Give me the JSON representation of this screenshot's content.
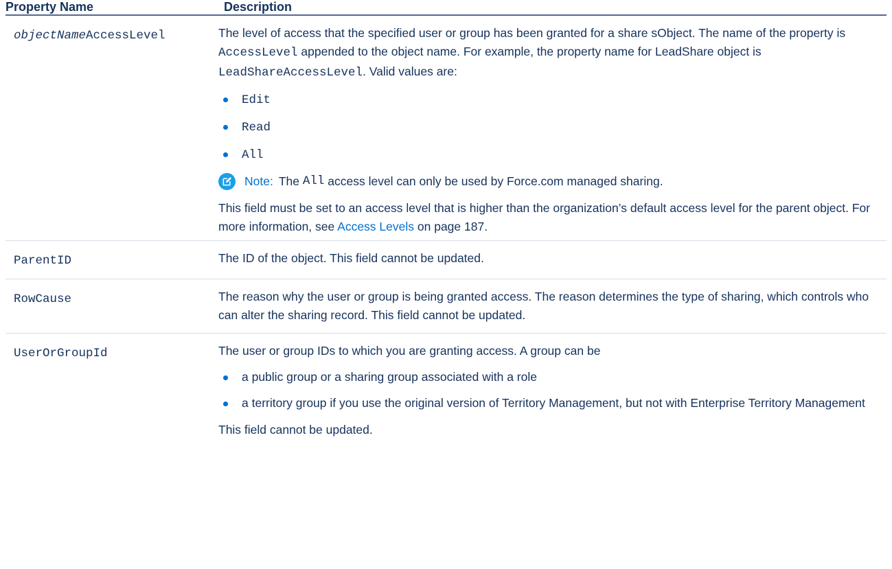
{
  "table": {
    "headers": {
      "property": "Property Name",
      "description": "Description"
    },
    "row1": {
      "name_italic": "objectName",
      "name_suffix": "AccessLevel",
      "desc": {
        "p1": "The level of access that the specified user or group has been granted for a share sObject. The name of the property is",
        "p1_code": "AccessLevel",
        "p1_b": "appended to the object name. For example, the property name for LeadShare object is",
        "p1_code2": "LeadShareAccessLevel",
        "p1_c": ". Valid values are:",
        "values": [
          "Edit",
          "Read",
          "All"
        ],
        "note_label": "Note:",
        "note_a": "The",
        "note_code": "All",
        "note_b": "access level can only be used by Force.com managed sharing.",
        "p2": "This field must be set to an access level that is higher than the organization’s default access level for the parent object. For more information, see",
        "p2_link": "Access Levels",
        "p2_b": "on page 187."
      }
    },
    "row2": {
      "name": "ParentID",
      "desc": "The ID of the object. This field cannot be updated."
    },
    "row3": {
      "name": "RowCause",
      "desc": "The reason why the user or group is being granted access. The reason determines the type of sharing, which controls who can alter the sharing record. This field cannot be updated."
    },
    "row4": {
      "name": "UserOrGroupId",
      "desc": "The user or group IDs to which you are granting access. A group can be",
      "items": [
        "a public group or a sharing group associated with a role",
        "a territory group if you use the original version of Territory Management, but not with Enterprise Territory Management"
      ],
      "after": "This field cannot be updated."
    }
  },
  "icons": {
    "note": "edit-pencil-icon"
  },
  "colors": {
    "text": "#16325c",
    "link": "#0070d2",
    "note_icon": "#1aa0e8"
  }
}
